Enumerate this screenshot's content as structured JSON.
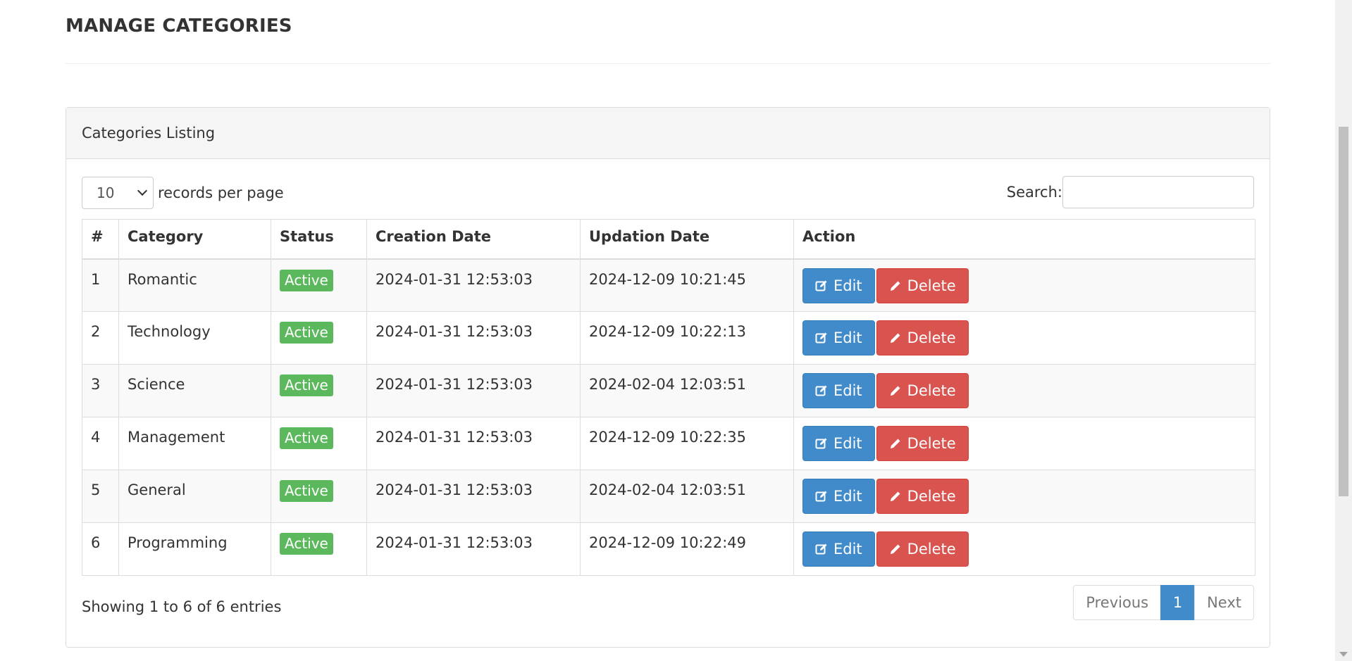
{
  "page": {
    "title": "MANAGE CATEGORIES"
  },
  "panel": {
    "heading": "Categories Listing"
  },
  "length_control": {
    "selected": "10",
    "suffix": "records per page"
  },
  "search": {
    "label": "Search:",
    "value": "",
    "placeholder": ""
  },
  "table": {
    "headers": [
      "#",
      "Category",
      "Status",
      "Creation Date",
      "Updation Date",
      "Action"
    ],
    "rows": [
      {
        "num": "1",
        "category": "Romantic",
        "status": "Active",
        "created": "2024-01-31 12:53:03",
        "updated": "2024-12-09 10:21:45",
        "edit_label": "Edit",
        "delete_label": "Delete"
      },
      {
        "num": "2",
        "category": "Technology",
        "status": "Active",
        "created": "2024-01-31 12:53:03",
        "updated": "2024-12-09 10:22:13",
        "edit_label": "Edit",
        "delete_label": "Delete"
      },
      {
        "num": "3",
        "category": "Science",
        "status": "Active",
        "created": "2024-01-31 12:53:03",
        "updated": "2024-02-04 12:03:51",
        "edit_label": "Edit",
        "delete_label": "Delete"
      },
      {
        "num": "4",
        "category": "Management",
        "status": "Active",
        "created": "2024-01-31 12:53:03",
        "updated": "2024-12-09 10:22:35",
        "edit_label": "Edit",
        "delete_label": "Delete"
      },
      {
        "num": "5",
        "category": "General",
        "status": "Active",
        "created": "2024-01-31 12:53:03",
        "updated": "2024-02-04 12:03:51",
        "edit_label": "Edit",
        "delete_label": "Delete"
      },
      {
        "num": "6",
        "category": "Programming",
        "status": "Active",
        "created": "2024-01-31 12:53:03",
        "updated": "2024-12-09 10:22:49",
        "edit_label": "Edit",
        "delete_label": "Delete"
      }
    ]
  },
  "info": "Showing 1 to 6 of 6 entries",
  "pagination": {
    "previous": "Previous",
    "current": "1",
    "next": "Next"
  },
  "colors": {
    "primary": "#428bca",
    "danger": "#d9534f",
    "success": "#5cb85c"
  },
  "icons": {
    "edit": "edit-icon",
    "delete": "pencil-icon",
    "select": "chevron-down-icon"
  }
}
